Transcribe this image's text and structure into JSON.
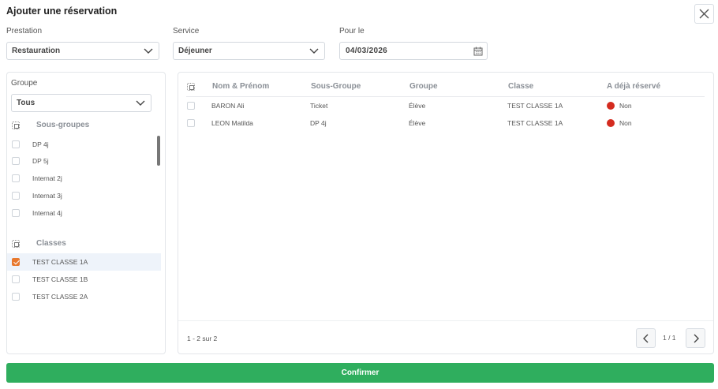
{
  "dialog": {
    "title": "Ajouter une réservation"
  },
  "filters": {
    "prestation": {
      "label": "Prestation",
      "value": "Restauration"
    },
    "service": {
      "label": "Service",
      "value": "Déjeuner"
    },
    "date": {
      "label": "Pour le",
      "value": "04/03/2026"
    }
  },
  "left": {
    "groupe_label": "Groupe",
    "groupe_value": "Tous",
    "sousgroupes_title": "Sous-groupes",
    "sousgroupes": [
      "DP 4j",
      "DP 5j",
      "Internat 2j",
      "Internat 3j",
      "Internat 4j"
    ],
    "classes_title": "Classes",
    "classes": [
      {
        "label": "TEST CLASSE 1A",
        "checked": true
      },
      {
        "label": "TEST CLASSE 1B",
        "checked": false
      },
      {
        "label": "TEST CLASSE 2A",
        "checked": false
      }
    ]
  },
  "table": {
    "headers": [
      "Nom & Prénom",
      "Sous-Groupe",
      "Groupe",
      "Classe",
      "A déjà réservé"
    ],
    "rows": [
      {
        "name": "BARON Ali",
        "sousgroupe": "Ticket",
        "groupe": "Élève",
        "classe": "TEST CLASSE 1A",
        "reserve": "Non"
      },
      {
        "name": "LEON Matilda",
        "sousgroupe": "DP 4j",
        "groupe": "Élève",
        "classe": "TEST CLASSE 1A",
        "reserve": "Non"
      }
    ],
    "status_color": "#d42b1f"
  },
  "pagination": {
    "info": "1 - 2 sur 2",
    "page": "1 / 1"
  },
  "confirm_label": "Confirmer",
  "colors": {
    "accent_orange": "#e8792f",
    "confirm_green": "#2fae5e"
  }
}
